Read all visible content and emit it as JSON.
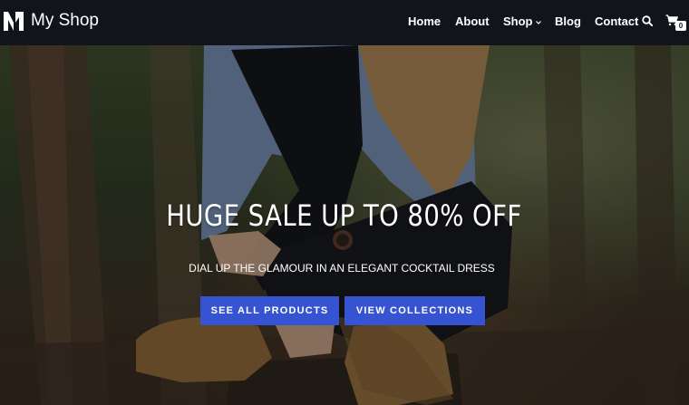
{
  "header": {
    "site_title": "My Shop",
    "logo_icon": "shop-logo-icon",
    "nav": [
      {
        "label": "Home"
      },
      {
        "label": "About"
      },
      {
        "label": "Shop",
        "has_dropdown": true
      },
      {
        "label": "Blog"
      },
      {
        "label": "Contact"
      }
    ],
    "search_icon": "search-icon",
    "cart_icon": "shopping-cart-icon",
    "cart_count": "0"
  },
  "hero": {
    "title": "HUGE SALE UP TO 80% OFF",
    "subtitle": "DIAL UP THE GLAMOUR IN AN ELEGANT COCKTAIL DRESS",
    "buttons": [
      {
        "label": "SEE ALL PRODUCTS"
      },
      {
        "label": "VIEW COLLECTIONS"
      }
    ],
    "background_image": "woman sitting on tree stump in forest wearing boots"
  },
  "colors": {
    "header_bg": "#11141a",
    "button_bg": "#3653d1",
    "text": "#ffffff"
  }
}
